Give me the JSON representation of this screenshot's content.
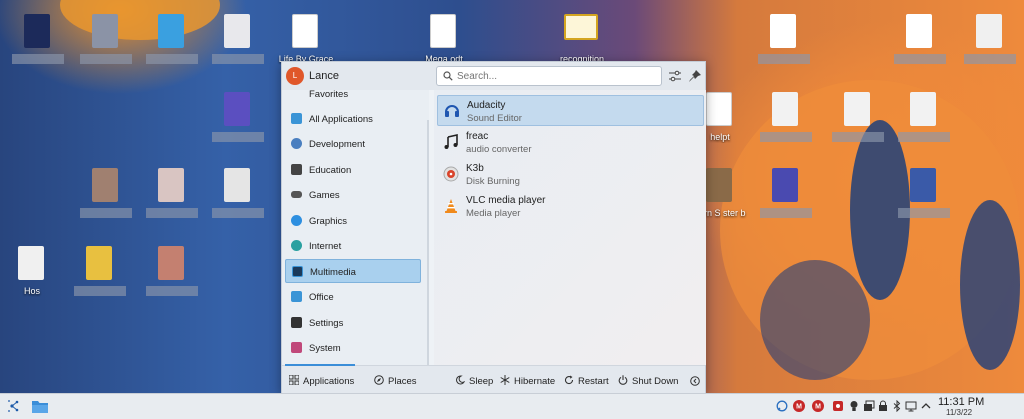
{
  "desktop": {
    "icons": [
      {
        "label": "Life By Grace",
        "kind": "doc"
      },
      {
        "label": "Mega.odt",
        "kind": "doc"
      },
      {
        "label": "recognition",
        "kind": "cert"
      },
      {
        "label": "Hos",
        "kind": "doc"
      },
      {
        "label": "helpt",
        "kind": "doc"
      },
      {
        "label": "vern S ster b",
        "kind": "image"
      }
    ]
  },
  "launcher": {
    "user_name": "Lance",
    "avatar_initial": "L",
    "search_placeholder": "Search...",
    "categories": [
      {
        "label": "Favorites",
        "icon": "star-icon"
      },
      {
        "label": "All Applications",
        "icon": "grid-icon"
      },
      {
        "label": "Development",
        "icon": "development-icon"
      },
      {
        "label": "Education",
        "icon": "education-icon"
      },
      {
        "label": "Games",
        "icon": "gamepad-icon"
      },
      {
        "label": "Graphics",
        "icon": "graphics-icon"
      },
      {
        "label": "Internet",
        "icon": "globe-icon"
      },
      {
        "label": "Multimedia",
        "icon": "multimedia-icon"
      },
      {
        "label": "Office",
        "icon": "office-icon"
      },
      {
        "label": "Settings",
        "icon": "settings-icon"
      },
      {
        "label": "System",
        "icon": "system-icon"
      }
    ],
    "selected_category": "Multimedia",
    "apps": [
      {
        "name": "Audacity",
        "desc": "Sound Editor",
        "icon": "audacity-icon"
      },
      {
        "name": "freac",
        "desc": "audio converter",
        "icon": "music-note-icon"
      },
      {
        "name": "K3b",
        "desc": "Disk Burning",
        "icon": "k3b-icon"
      },
      {
        "name": "VLC media player",
        "desc": "Media player",
        "icon": "vlc-cone-icon"
      }
    ],
    "footer": {
      "applications": "Applications",
      "places": "Places",
      "sleep": "Sleep",
      "hibernate": "Hibernate",
      "restart": "Restart",
      "shutdown": "Shut Down"
    }
  },
  "taskbar": {
    "time": "11:31 PM",
    "date": "11/3/22"
  },
  "colors": {
    "accent": "#3b8ed8",
    "selection": "#a9d0ee",
    "avatar": "#e0572a"
  }
}
